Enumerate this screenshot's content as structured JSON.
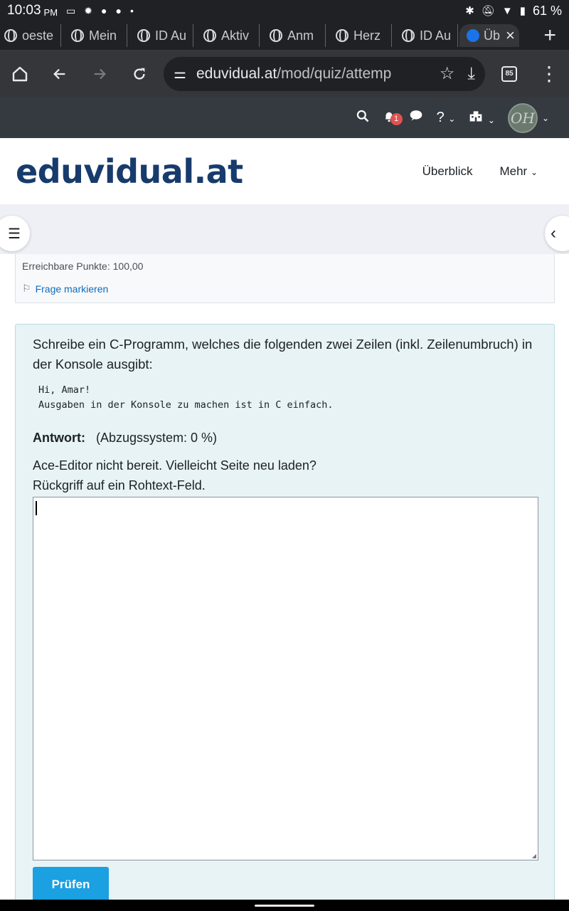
{
  "status_bar": {
    "time": "10:03",
    "ampm": "PM",
    "battery": "61 %"
  },
  "tabs": [
    {
      "label": "oeste"
    },
    {
      "label": "Mein"
    },
    {
      "label": "ID Au"
    },
    {
      "label": "Aktiv"
    },
    {
      "label": "Anm"
    },
    {
      "label": "Herz"
    },
    {
      "label": "ID Au"
    },
    {
      "label": "Üb",
      "active": true
    }
  ],
  "toolbar": {
    "url_host": "eduvidual.at",
    "url_path": "/mod/quiz/attemp",
    "tab_count": "85"
  },
  "navbar": {
    "notification_count": "1"
  },
  "header": {
    "logo": "eduvidual.at",
    "nav": [
      "Überblick",
      "Mehr"
    ]
  },
  "question_info": {
    "points": "Erreichbare Punkte: 100,00",
    "flag_label": "Frage markieren"
  },
  "question": {
    "text": "Schreibe ein C-Programm, welches die folgenden zwei Zeilen (inkl. Zeilenumbruch) in der Konsole ausgibt:",
    "code": "Hi, Amar!\nAusgaben in der Konsole zu machen ist in C einfach.",
    "answer_label": "Antwort:",
    "penalty": "(Abzugssystem: 0 %)",
    "editor_notice": "Ace-Editor nicht bereit. Vielleicht Seite neu laden?\nRückgriff auf ein Rohtext-Feld.",
    "answer_value": "",
    "check_button": "Prüfen"
  }
}
